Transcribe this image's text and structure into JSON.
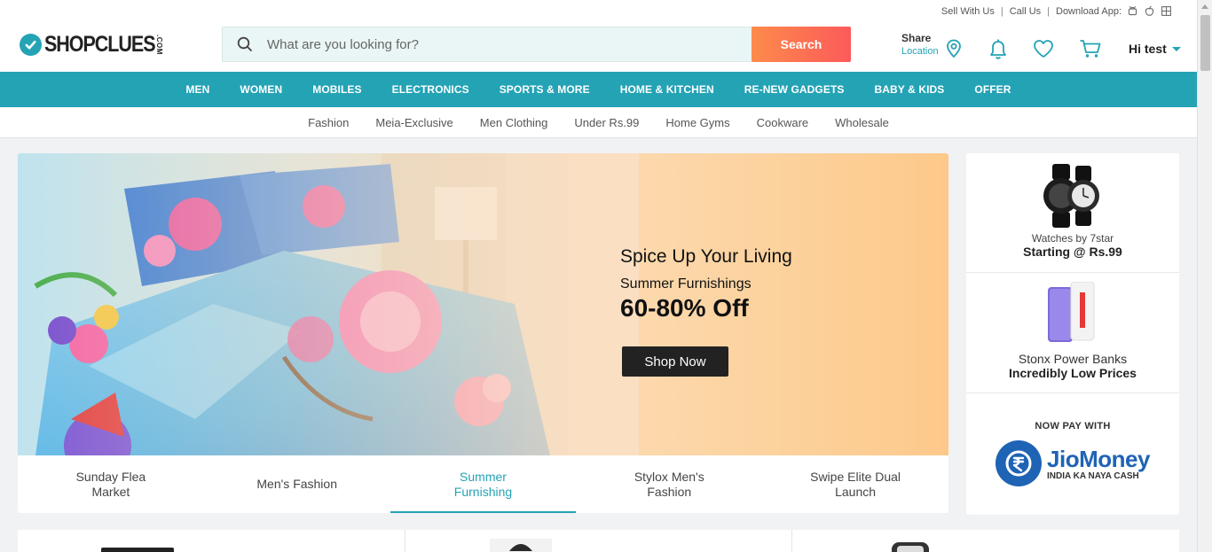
{
  "header": {
    "links": [
      "Sell With Us",
      "Call Us"
    ],
    "download_label": "Download App:",
    "logo_text": "SHOPCLUES",
    "logo_suffix": ".COM",
    "search_placeholder": "What are you looking for?",
    "search_button": "Search",
    "share_label": "Share",
    "location_label": "Location",
    "user_greeting": "Hi test"
  },
  "nav": {
    "categories": [
      "MEN",
      "WOMEN",
      "MOBILES",
      "ELECTRONICS",
      "SPORTS & MORE",
      "HOME & KITCHEN",
      "RE-NEW GADGETS",
      "BABY & KIDS",
      "OFFER"
    ],
    "subcategories": [
      "Fashion",
      "Meia-Exclusive",
      "Men Clothing",
      "Under Rs.99",
      "Home Gyms",
      "Cookware",
      "Wholesale"
    ]
  },
  "banner": {
    "title": "Spice Up Your Living",
    "subtitle": "Summer Furnishings",
    "discount": "60-80% Off",
    "cta": "Shop Now"
  },
  "banner_tabs": [
    {
      "label": "Sunday Flea Market",
      "active": false
    },
    {
      "label": "Men's Fashion",
      "active": false
    },
    {
      "label": "Summer Furnishing",
      "active": true
    },
    {
      "label": "Stylox Men's Fashion",
      "active": false
    },
    {
      "label": "Swipe Elite Dual Launch",
      "active": false
    }
  ],
  "side_promos": {
    "watches_caption": "Watches by 7star",
    "watches_offer": "Starting @ Rs.99",
    "powerbank_caption": "Stonx Power Banks",
    "powerbank_offer": "Incredibly Low Prices",
    "pay_label": "NOW PAY WITH",
    "pay_brand": "JioMoney",
    "pay_tagline": "INDIA KA NAYA CASH"
  },
  "colors": {
    "brand": "#24a3b5",
    "search_button_start": "#fd8b4b",
    "search_button_end": "#fc5a5a",
    "jio_blue": "#1f63b5"
  },
  "icons": [
    "search-icon",
    "android-icon",
    "apple-icon",
    "windows-icon",
    "location-pin-icon",
    "bell-icon",
    "heart-icon",
    "cart-icon",
    "chevron-down-icon"
  ]
}
